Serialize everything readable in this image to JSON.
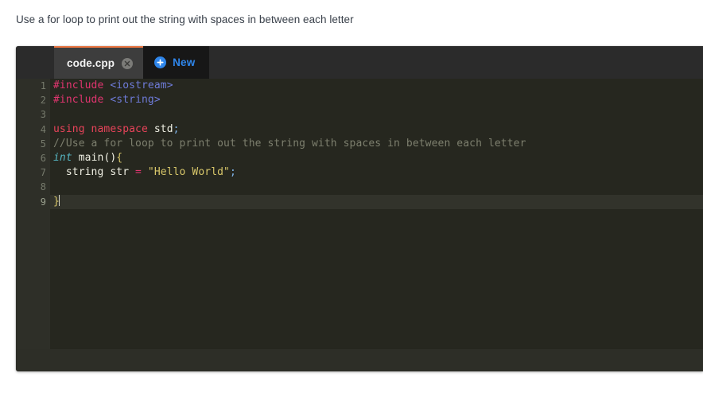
{
  "prompt": {
    "text": "Use a for loop to print out the string with spaces in between each letter"
  },
  "editor": {
    "tab": {
      "label": "code.cpp",
      "close_icon": "close-circle-icon",
      "accent_color": "#e8733f"
    },
    "new_button": {
      "label": "New",
      "icon": "plus-circle-icon",
      "color": "#2f86eb"
    },
    "colors": {
      "panel_bg": "#2d2e27",
      "code_bg": "#26271f",
      "gutter_bg": "#2e2f28",
      "tabstrip_bg": "#2b2b2b",
      "active_tab_bg": "#3d3d3d",
      "active_line_bg": "#32332b"
    },
    "active_line": 9,
    "lines": [
      {
        "number": "1",
        "fold": false,
        "active": false,
        "tokens": [
          {
            "text": "#include",
            "cls": "t-pre"
          },
          {
            "text": " ",
            "cls": "t-plain"
          },
          {
            "text": "<iostream>",
            "cls": "t-header"
          }
        ]
      },
      {
        "number": "2",
        "fold": false,
        "active": false,
        "tokens": [
          {
            "text": "#include",
            "cls": "t-pre"
          },
          {
            "text": " ",
            "cls": "t-plain"
          },
          {
            "text": "<string>",
            "cls": "t-header"
          }
        ]
      },
      {
        "number": "3",
        "fold": false,
        "active": false,
        "tokens": []
      },
      {
        "number": "4",
        "fold": false,
        "active": false,
        "tokens": [
          {
            "text": "using namespace",
            "cls": "t-kw"
          },
          {
            "text": " ",
            "cls": "t-plain"
          },
          {
            "text": "std",
            "cls": "t-plain"
          },
          {
            "text": ";",
            "cls": "t-punc"
          }
        ]
      },
      {
        "number": "5",
        "fold": false,
        "active": false,
        "tokens": [
          {
            "text": "//Use a for loop to print out the string with spaces in between each letter",
            "cls": "t-comment"
          }
        ]
      },
      {
        "number": "6",
        "fold": true,
        "active": false,
        "tokens": [
          {
            "text": "int",
            "cls": "t-type"
          },
          {
            "text": " ",
            "cls": "t-plain"
          },
          {
            "text": "main",
            "cls": "t-plain"
          },
          {
            "text": "()",
            "cls": "t-plain"
          },
          {
            "text": "{",
            "cls": "t-brace"
          }
        ]
      },
      {
        "number": "7",
        "fold": false,
        "active": false,
        "tokens": [
          {
            "text": "  string str ",
            "cls": "t-plain"
          },
          {
            "text": "=",
            "cls": "t-op"
          },
          {
            "text": " ",
            "cls": "t-plain"
          },
          {
            "text": "\"Hello World\"",
            "cls": "t-str"
          },
          {
            "text": ";",
            "cls": "t-punc"
          }
        ]
      },
      {
        "number": "8",
        "fold": false,
        "active": false,
        "tokens": []
      },
      {
        "number": "9",
        "fold": false,
        "active": true,
        "caret": true,
        "tokens": [
          {
            "text": "}",
            "cls": "t-brace"
          }
        ]
      }
    ]
  }
}
